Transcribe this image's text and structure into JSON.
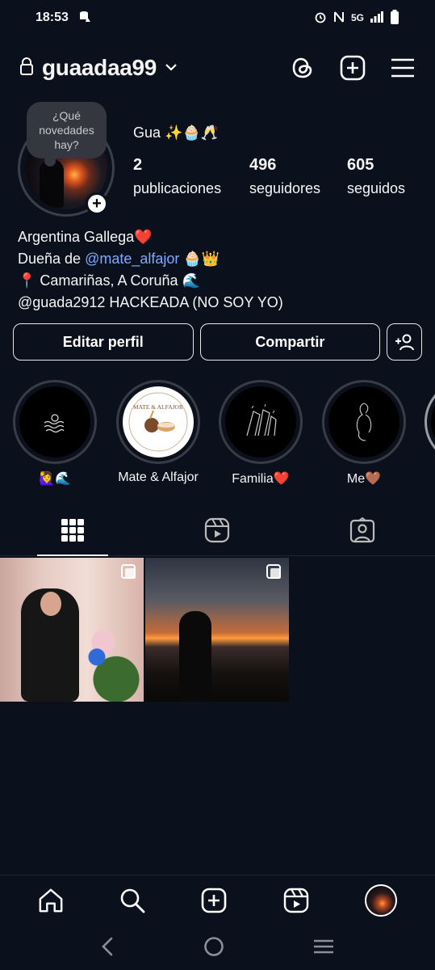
{
  "status_bar": {
    "time": "18:53",
    "network": "5G"
  },
  "header": {
    "username": "guaadaa99"
  },
  "profile": {
    "note": "¿Qué novedades hay?",
    "display_name": "Gua ✨🧁🥂",
    "stats": [
      {
        "value": "2",
        "label": "publicaciones"
      },
      {
        "value": "496",
        "label": "seguidores"
      },
      {
        "value": "605",
        "label": "seguidos"
      }
    ],
    "bio": {
      "line1": "Argentina Gallega❤️",
      "line2_prefix": "Dueña de ",
      "line2_mention": "@mate_alfajor",
      "line2_suffix": " 🧁👑",
      "line3": "📍 Camariñas, A Coruña 🌊",
      "line4": "@guada2912 HACKEADA (NO SOY YO)"
    }
  },
  "actions": {
    "edit": "Editar perfil",
    "share": "Compartir"
  },
  "highlights": [
    {
      "label": "🙋‍♀️🌊"
    },
    {
      "label": "Mate & Alfajor",
      "logo_text": "MATE & ALFAJOR"
    },
    {
      "label": "Familia❤️"
    },
    {
      "label": "Me🤎"
    }
  ],
  "colors": {
    "background": "#0b111c",
    "mention": "#7fa9ff"
  }
}
